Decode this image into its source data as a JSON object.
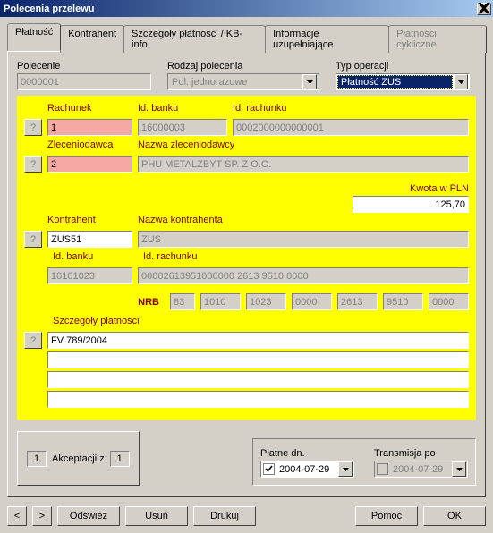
{
  "window": {
    "title": "Polecenia przelewu",
    "close_icon": "✕"
  },
  "tabs": {
    "t0": "Płatność",
    "t1": "Kontrahent",
    "t2": "Szczegóły płatności / KB-info",
    "t3": "Informacje uzupełniające",
    "t4": "Płatności cykliczne"
  },
  "top": {
    "polecenie_label": "Polecenie",
    "polecenie_value": "0000001",
    "rodzaj_label": "Rodzaj polecenia",
    "rodzaj_value": "Pol. jednorazowe",
    "typ_label": "Typ operacji",
    "typ_value": "Płatność ZUS"
  },
  "sec1": {
    "rachunek_label": "Rachunek",
    "rachunek_value": "1",
    "idbanku_label": "Id. banku",
    "idbanku_value": "16000003",
    "idrach_label": "Id. rachunku",
    "idrach_value": "0002000000000001",
    "zlec_label": "Zleceniodawca",
    "zlec_value": "2",
    "nazwa_zlec_label": "Nazwa zleceniodawcy",
    "nazwa_zlec_value": "PHU METALZBYT SP. Z O.O."
  },
  "kwota": {
    "label": "Kwota w PLN",
    "value": "125,70"
  },
  "sec2": {
    "kontrahent_label": "Kontrahent",
    "kontrahent_value": "ZUS51",
    "nazwa_k_label": "Nazwa kontrahenta",
    "nazwa_k_value": "ZUS",
    "idbanku_label": "Id. banku",
    "idbanku_value": "10101023",
    "idrach_label": "Id. rachunku",
    "idrach_value": "00002613951000000 2613 9510 0000"
  },
  "nrb": {
    "label": "NRB",
    "p0": "83",
    "p1": "1010",
    "p2": "1023",
    "p3": "0000",
    "p4": "2613",
    "p5": "9510",
    "p6": "0000"
  },
  "szcz": {
    "label": "Szczegóły płatności",
    "l1": "FV 789/2004",
    "l2": "",
    "l3": "",
    "l4": ""
  },
  "akc": {
    "n1": "1",
    "label": "Akceptacji z",
    "n2": "1"
  },
  "dates": {
    "platne_label": "Płatne dn.",
    "platne_value": "2004-07-29",
    "trans_label": "Transmisja po",
    "trans_value": "2004-07-29"
  },
  "footer": {
    "prev": "<",
    "next": ">",
    "odswiez": "Odśwież",
    "usun": "Usuń",
    "drukuj": "Drukuj",
    "pomoc": "Pomoc",
    "ok": "OK"
  },
  "q": "?"
}
